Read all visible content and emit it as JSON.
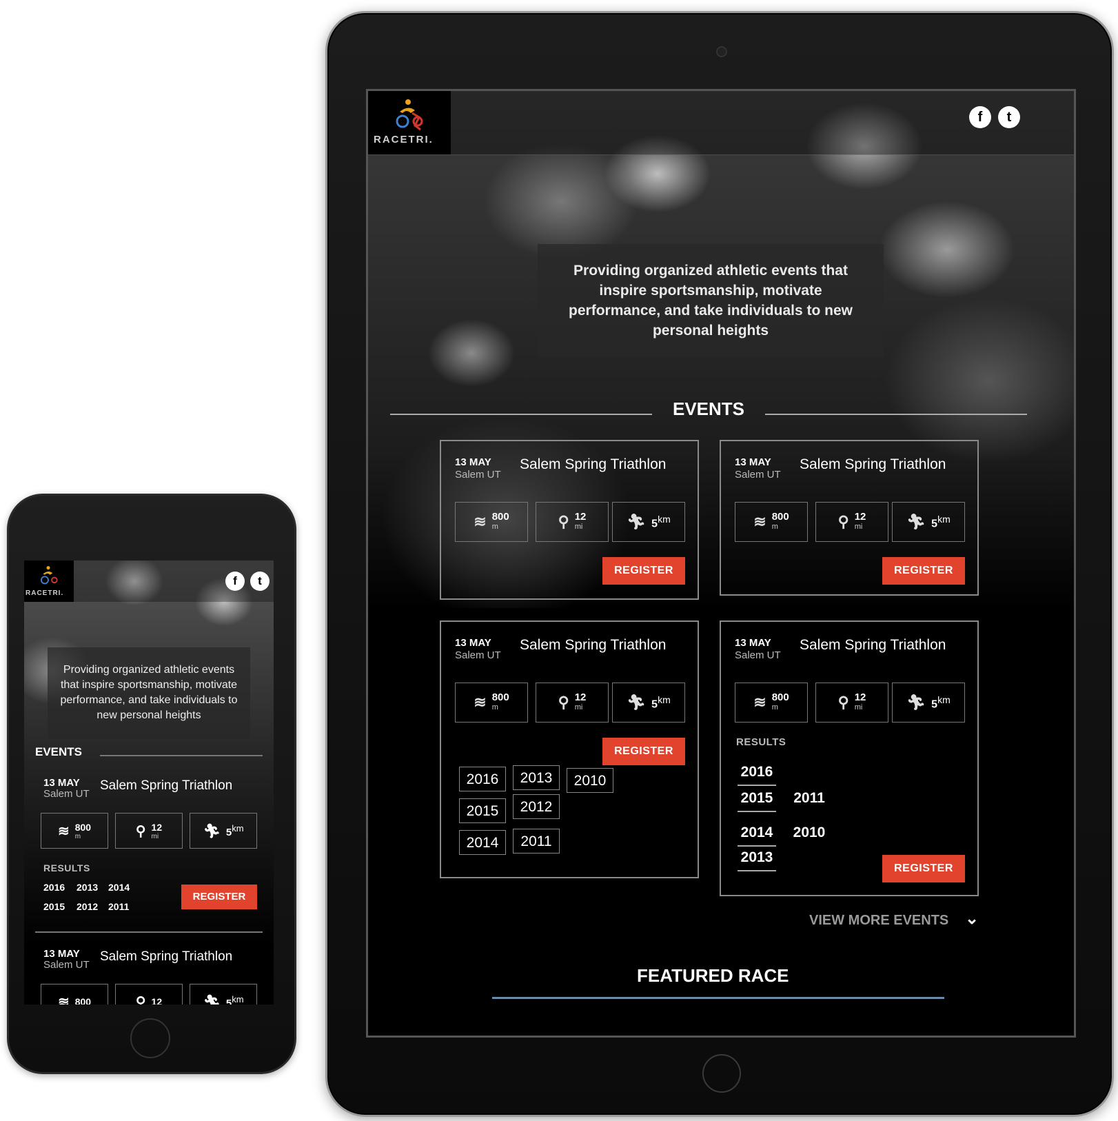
{
  "brand": {
    "logo_text": "RACETRI."
  },
  "social": {
    "facebook_glyph": "f",
    "twitter_glyph": "t"
  },
  "hero": {
    "tagline": "Providing organized athletic events that inspire sportsmanship, motivate performance, and take individuals to new personal heights"
  },
  "events_heading": "EVENTS",
  "event": {
    "date": "13 MAY",
    "city": "Salem UT",
    "name": "Salem Spring Triathlon",
    "swim": {
      "value": "800",
      "unit": "m"
    },
    "bike": {
      "value": "12",
      "unit": "mi"
    },
    "run": {
      "value": "5",
      "unit": "km"
    },
    "register": "REGISTER"
  },
  "results_label": "RESULTS",
  "card3_years": [
    "2016",
    "2013",
    "2010",
    "2015",
    "2012",
    "2014",
    "2011"
  ],
  "card4_years": [
    "2016",
    "2015",
    "2011",
    "2014",
    "2010",
    "2013"
  ],
  "phone_years": [
    "2016",
    "2013",
    "2014",
    "2015",
    "2012",
    "2011"
  ],
  "view_more": "VIEW MORE EVENTS",
  "featured": "FEATURED RACE",
  "colors": {
    "accent": "#e2432d",
    "background": "#000000"
  }
}
